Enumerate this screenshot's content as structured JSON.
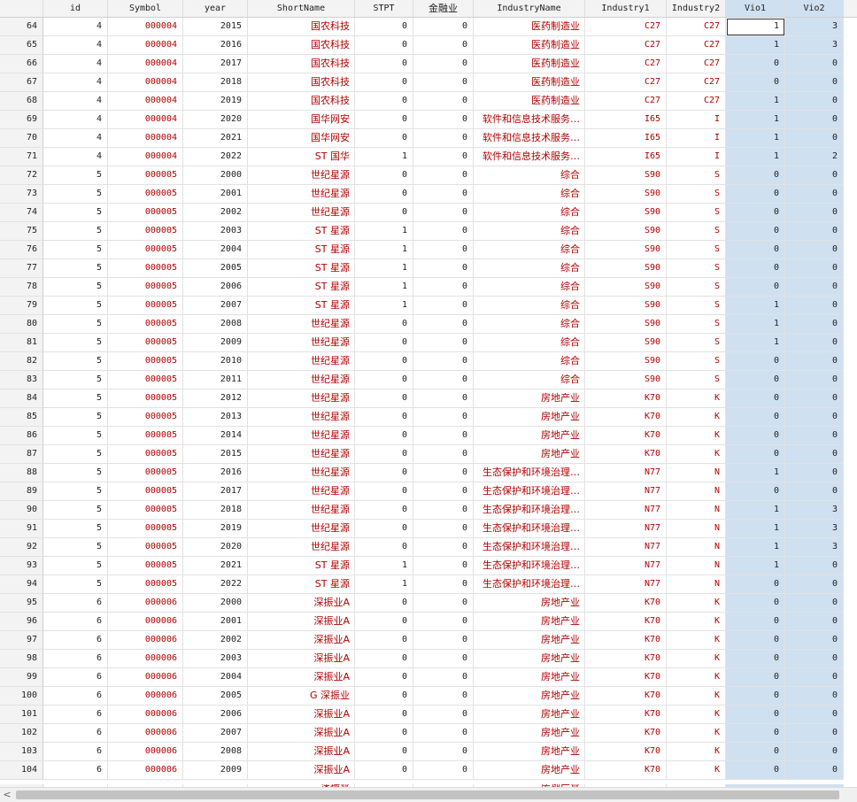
{
  "headers": [
    "",
    "id",
    "Symbol",
    "year",
    "ShortName",
    "STPT",
    "金融业",
    "IndustryName",
    "Industry1",
    "Industry2",
    "Vio1",
    "Vio2"
  ],
  "rows": [
    [
      "64",
      "4",
      "000004",
      "2015",
      "国农科技",
      "0",
      "0",
      "医药制造业",
      "C27",
      "C27",
      "1",
      "3"
    ],
    [
      "65",
      "4",
      "000004",
      "2016",
      "国农科技",
      "0",
      "0",
      "医药制造业",
      "C27",
      "C27",
      "1",
      "3"
    ],
    [
      "66",
      "4",
      "000004",
      "2017",
      "国农科技",
      "0",
      "0",
      "医药制造业",
      "C27",
      "C27",
      "0",
      "0"
    ],
    [
      "67",
      "4",
      "000004",
      "2018",
      "国农科技",
      "0",
      "0",
      "医药制造业",
      "C27",
      "C27",
      "0",
      "0"
    ],
    [
      "68",
      "4",
      "000004",
      "2019",
      "国农科技",
      "0",
      "0",
      "医药制造业",
      "C27",
      "C27",
      "1",
      "0"
    ],
    [
      "69",
      "4",
      "000004",
      "2020",
      "国华网安",
      "0",
      "0",
      "软件和信息技术服务…",
      "I65",
      "I",
      "1",
      "0"
    ],
    [
      "70",
      "4",
      "000004",
      "2021",
      "国华网安",
      "0",
      "0",
      "软件和信息技术服务…",
      "I65",
      "I",
      "1",
      "0"
    ],
    [
      "71",
      "4",
      "000004",
      "2022",
      "ST 国华",
      "1",
      "0",
      "软件和信息技术服务…",
      "I65",
      "I",
      "1",
      "2"
    ],
    [
      "72",
      "5",
      "000005",
      "2000",
      "世纪星源",
      "0",
      "0",
      "综合",
      "S90",
      "S",
      "0",
      "0"
    ],
    [
      "73",
      "5",
      "000005",
      "2001",
      "世纪星源",
      "0",
      "0",
      "综合",
      "S90",
      "S",
      "0",
      "0"
    ],
    [
      "74",
      "5",
      "000005",
      "2002",
      "世纪星源",
      "0",
      "0",
      "综合",
      "S90",
      "S",
      "0",
      "0"
    ],
    [
      "75",
      "5",
      "000005",
      "2003",
      "ST 星源",
      "1",
      "0",
      "综合",
      "S90",
      "S",
      "0",
      "0"
    ],
    [
      "76",
      "5",
      "000005",
      "2004",
      "ST 星源",
      "1",
      "0",
      "综合",
      "S90",
      "S",
      "0",
      "0"
    ],
    [
      "77",
      "5",
      "000005",
      "2005",
      "ST 星源",
      "1",
      "0",
      "综合",
      "S90",
      "S",
      "0",
      "0"
    ],
    [
      "78",
      "5",
      "000005",
      "2006",
      "ST 星源",
      "1",
      "0",
      "综合",
      "S90",
      "S",
      "0",
      "0"
    ],
    [
      "79",
      "5",
      "000005",
      "2007",
      "ST 星源",
      "1",
      "0",
      "综合",
      "S90",
      "S",
      "1",
      "0"
    ],
    [
      "80",
      "5",
      "000005",
      "2008",
      "世纪星源",
      "0",
      "0",
      "综合",
      "S90",
      "S",
      "1",
      "0"
    ],
    [
      "81",
      "5",
      "000005",
      "2009",
      "世纪星源",
      "0",
      "0",
      "综合",
      "S90",
      "S",
      "1",
      "0"
    ],
    [
      "82",
      "5",
      "000005",
      "2010",
      "世纪星源",
      "0",
      "0",
      "综合",
      "S90",
      "S",
      "0",
      "0"
    ],
    [
      "83",
      "5",
      "000005",
      "2011",
      "世纪星源",
      "0",
      "0",
      "综合",
      "S90",
      "S",
      "0",
      "0"
    ],
    [
      "84",
      "5",
      "000005",
      "2012",
      "世纪星源",
      "0",
      "0",
      "房地产业",
      "K70",
      "K",
      "0",
      "0"
    ],
    [
      "85",
      "5",
      "000005",
      "2013",
      "世纪星源",
      "0",
      "0",
      "房地产业",
      "K70",
      "K",
      "0",
      "0"
    ],
    [
      "86",
      "5",
      "000005",
      "2014",
      "世纪星源",
      "0",
      "0",
      "房地产业",
      "K70",
      "K",
      "0",
      "0"
    ],
    [
      "87",
      "5",
      "000005",
      "2015",
      "世纪星源",
      "0",
      "0",
      "房地产业",
      "K70",
      "K",
      "0",
      "0"
    ],
    [
      "88",
      "5",
      "000005",
      "2016",
      "世纪星源",
      "0",
      "0",
      "生态保护和环境治理…",
      "N77",
      "N",
      "1",
      "0"
    ],
    [
      "89",
      "5",
      "000005",
      "2017",
      "世纪星源",
      "0",
      "0",
      "生态保护和环境治理…",
      "N77",
      "N",
      "0",
      "0"
    ],
    [
      "90",
      "5",
      "000005",
      "2018",
      "世纪星源",
      "0",
      "0",
      "生态保护和环境治理…",
      "N77",
      "N",
      "1",
      "3"
    ],
    [
      "91",
      "5",
      "000005",
      "2019",
      "世纪星源",
      "0",
      "0",
      "生态保护和环境治理…",
      "N77",
      "N",
      "1",
      "3"
    ],
    [
      "92",
      "5",
      "000005",
      "2020",
      "世纪星源",
      "0",
      "0",
      "生态保护和环境治理…",
      "N77",
      "N",
      "1",
      "3"
    ],
    [
      "93",
      "5",
      "000005",
      "2021",
      "ST 星源",
      "1",
      "0",
      "生态保护和环境治理…",
      "N77",
      "N",
      "1",
      "0"
    ],
    [
      "94",
      "5",
      "000005",
      "2022",
      "ST 星源",
      "1",
      "0",
      "生态保护和环境治理…",
      "N77",
      "N",
      "0",
      "0"
    ],
    [
      "95",
      "6",
      "000006",
      "2000",
      "深振业A",
      "0",
      "0",
      "房地产业",
      "K70",
      "K",
      "0",
      "0"
    ],
    [
      "96",
      "6",
      "000006",
      "2001",
      "深振业A",
      "0",
      "0",
      "房地产业",
      "K70",
      "K",
      "0",
      "0"
    ],
    [
      "97",
      "6",
      "000006",
      "2002",
      "深振业A",
      "0",
      "0",
      "房地产业",
      "K70",
      "K",
      "0",
      "0"
    ],
    [
      "98",
      "6",
      "000006",
      "2003",
      "深振业A",
      "0",
      "0",
      "房地产业",
      "K70",
      "K",
      "0",
      "0"
    ],
    [
      "99",
      "6",
      "000006",
      "2004",
      "深振业A",
      "0",
      "0",
      "房地产业",
      "K70",
      "K",
      "0",
      "0"
    ],
    [
      "100",
      "6",
      "000006",
      "2005",
      "G 深振业",
      "0",
      "0",
      "房地产业",
      "K70",
      "K",
      "0",
      "0"
    ],
    [
      "101",
      "6",
      "000006",
      "2006",
      "深振业A",
      "0",
      "0",
      "房地产业",
      "K70",
      "K",
      "0",
      "0"
    ],
    [
      "102",
      "6",
      "000006",
      "2007",
      "深振业A",
      "0",
      "0",
      "房地产业",
      "K70",
      "K",
      "0",
      "0"
    ],
    [
      "103",
      "6",
      "000006",
      "2008",
      "深振业A",
      "0",
      "0",
      "房地产业",
      "K70",
      "K",
      "0",
      "0"
    ],
    [
      "104",
      "6",
      "000006",
      "2009",
      "深振业A",
      "0",
      "0",
      "房地产业",
      "K70",
      "K",
      "0",
      "0"
    ]
  ],
  "partial_row": [
    "",
    "",
    "",
    "",
    "深振业",
    "",
    "",
    "房地产业",
    "",
    "",
    "",
    ""
  ],
  "scrollbar": {
    "left_arrow": "<"
  }
}
